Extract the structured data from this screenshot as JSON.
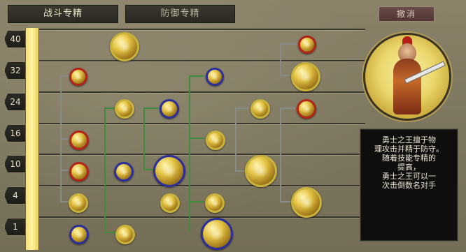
{
  "tabs": {
    "combat": "战斗专精",
    "defense": "防御专精"
  },
  "cancel_label": "撤消",
  "levels": [
    "40",
    "32",
    "24",
    "16",
    "10",
    "4",
    "1"
  ],
  "description": "勇士之王擅于物\n理攻击并精于防守。\n随着技能专精的\n提高，\n勇士之王可以一\n次击倒数名对手",
  "icons": {
    "portrait": "warrior-king-portrait",
    "skills": "skill-orb-icon"
  },
  "colors": {
    "progress_bar": "#f4e27a",
    "ring_red": "#b3231a",
    "ring_blue": "#2b2f9c",
    "connector_green": "#3d8d3d",
    "connector_gray": "#8a8a8a"
  }
}
